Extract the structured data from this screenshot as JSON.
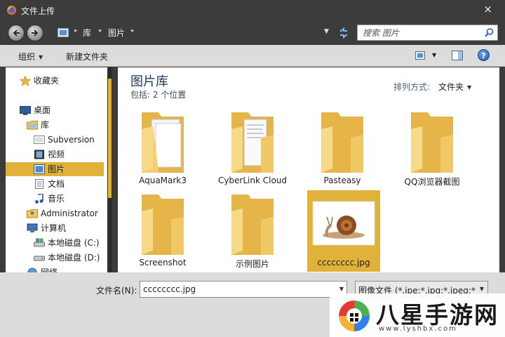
{
  "window": {
    "title": "文件上传",
    "close_glyph": "×"
  },
  "address": {
    "breadcrumbs": [
      "库",
      "图片"
    ],
    "search_placeholder": "搜索 图片"
  },
  "toolbar": {
    "organize_label": "组织",
    "new_folder_label": "新建文件夹",
    "help_glyph": "?"
  },
  "nav": {
    "favorites": "收藏夹",
    "desktop": "桌面",
    "libraries": "库",
    "subversion": "Subversion",
    "videos": "视频",
    "pictures": "图片",
    "documents": "文档",
    "music": "音乐",
    "administrator": "Administrator",
    "computer": "计算机",
    "drive_c": "本地磁盘 (C:)",
    "drive_d": "本地磁盘 (D:)",
    "network": "网络",
    "selected": "图片"
  },
  "content": {
    "library_title": "图片库",
    "library_subtitle": "包括: 2 个位置",
    "arrange_label": "排列方式:",
    "arrange_value": "文件夹"
  },
  "items": [
    {
      "name": "AquaMark3",
      "kind": "folder"
    },
    {
      "name": "CyberLink Cloud",
      "kind": "folder"
    },
    {
      "name": "Pasteasy",
      "kind": "folder"
    },
    {
      "name": "QQ浏览器截图",
      "kind": "folder"
    },
    {
      "name": "Screenshot",
      "kind": "folder"
    },
    {
      "name": "示例图片",
      "kind": "folder"
    },
    {
      "name": "cccccccc.jpg",
      "kind": "image",
      "selected": true
    }
  ],
  "footer": {
    "filename_label": "文件名(N):",
    "filename_value": "cccccccc.jpg",
    "filetype_value": "图像文件 (*.jpe;*.jpg;*.jpeg;*.g"
  },
  "watermark": {
    "text": "八星手游网",
    "url": "www.lyshbx.com"
  },
  "colors": {
    "accent": "#e0b23a",
    "chrome": "#3c3c3c",
    "toolbar": "#dcdcdc"
  }
}
